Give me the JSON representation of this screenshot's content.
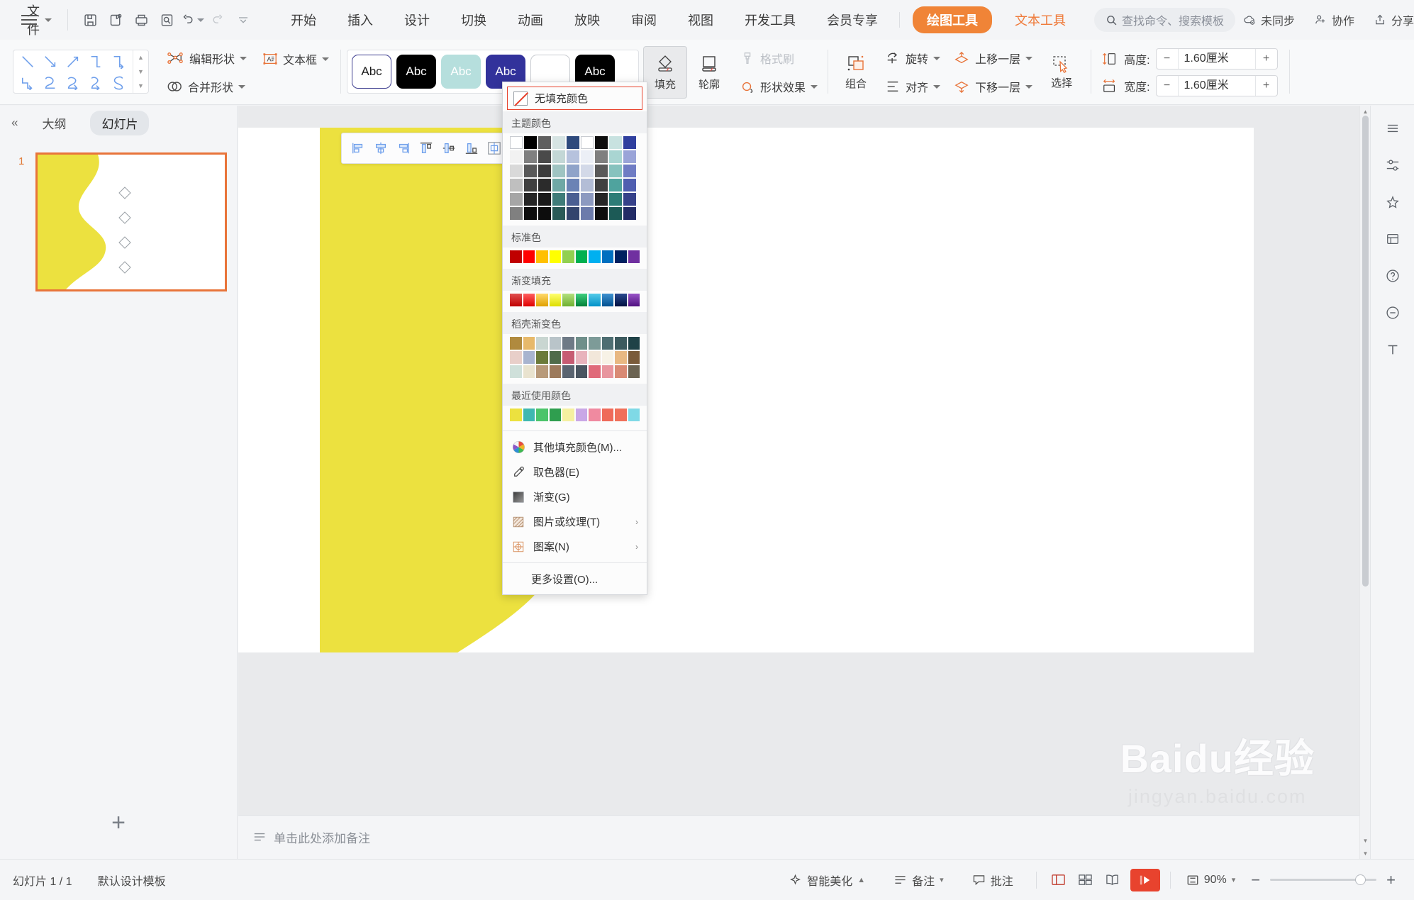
{
  "app": {
    "file_menu": "文件",
    "quick_access": [
      {
        "name": "save-icon",
        "title": "保存"
      },
      {
        "name": "save-as-icon",
        "title": "另存为"
      },
      {
        "name": "print-icon",
        "title": "打印"
      },
      {
        "name": "print-preview-icon",
        "title": "打印预览"
      },
      {
        "name": "undo-icon",
        "title": "撤销"
      },
      {
        "name": "redo-icon",
        "title": "恢复"
      },
      {
        "name": "customize-qat-icon",
        "title": "自定义快速访问工具栏"
      }
    ],
    "tabs": [
      {
        "label": "开始",
        "style": "normal"
      },
      {
        "label": "插入",
        "style": "normal"
      },
      {
        "label": "设计",
        "style": "normal"
      },
      {
        "label": "切换",
        "style": "normal"
      },
      {
        "label": "动画",
        "style": "normal"
      },
      {
        "label": "放映",
        "style": "normal"
      },
      {
        "label": "审阅",
        "style": "normal"
      },
      {
        "label": "视图",
        "style": "normal"
      },
      {
        "label": "开发工具",
        "style": "normal"
      },
      {
        "label": "会员专享",
        "style": "normal"
      },
      {
        "label": "绘图工具",
        "style": "pill"
      },
      {
        "label": "文本工具",
        "style": "accent"
      }
    ],
    "search_placeholder": "查找命令、搜索模板",
    "right_buttons": [
      {
        "label": "未同步",
        "icon": "cloud-off-icon"
      },
      {
        "label": "协作",
        "icon": "collaborate-icon"
      },
      {
        "label": "分享",
        "icon": "share-icon"
      }
    ],
    "more_icon": "more-vertical-icon",
    "collapse_ribbon_icon": "chevron-up-icon",
    "accent_color": "#f08437",
    "accent_text_color": "#ef7a3a"
  },
  "ribbon": {
    "shape_gallery": {
      "name": "line-shapes-gallery",
      "rows": [
        [
          "line-diagonal",
          "line-arrow-diagonal",
          "line-arrow-up",
          "elbow-connector",
          "elbow-arrow-connector"
        ],
        [
          "elbow-arrow-2",
          "curve-connector",
          "curve-arrow-connector",
          "curve-arrow-2",
          "s-curve"
        ]
      ]
    },
    "edit_shape": "编辑形状",
    "merge_shape": "合并形状",
    "text_box": "文本框",
    "style_swatches": [
      {
        "name": "style-white",
        "bg": "#ffffff",
        "text": "Abc",
        "fg": "#1a1a1a",
        "border": "#3d3d8f"
      },
      {
        "name": "style-black",
        "bg": "#000000",
        "text": "Abc",
        "fg": "#ffffff",
        "border": "#000000"
      },
      {
        "name": "style-lightteal",
        "bg": "#b6dfdd",
        "text": "Abc",
        "fg": "#ffffff",
        "border": "#b6dfdd"
      },
      {
        "name": "style-indigo",
        "bg": "#32329b",
        "text": "Abc",
        "fg": "#ffffff",
        "border": "#32329b"
      },
      {
        "name": "style-plain-white",
        "bg": "#ffffff",
        "text": "",
        "fg": "#1a1a1a",
        "border": "#c9ccd1"
      },
      {
        "name": "style-black-2",
        "bg": "#000000",
        "text": "Abc",
        "fg": "#ffffff",
        "border": "#000000"
      }
    ],
    "fill_label": "填充",
    "outline_label": "轮廓",
    "format_painter": "格式刷",
    "shape_effect": "形状效果",
    "group": "组合",
    "rotate": "旋转",
    "bring_forward": "上移一层",
    "align": "对齐",
    "send_backward": "下移一层",
    "select": "选择",
    "height_label": "高度:",
    "height_value": "1.60厘米",
    "width_label": "宽度:",
    "width_value": "1.60厘米",
    "minus": "−",
    "plus": "+"
  },
  "left_panel": {
    "collapse": "«",
    "tabs": [
      {
        "label": "大纲",
        "selected": false
      },
      {
        "label": "幻灯片",
        "selected": true
      }
    ],
    "slide_number": "1",
    "add_slide": "+"
  },
  "canvas": {
    "align_toolbar": [
      "align-left-icon",
      "align-center-h-icon",
      "align-right-icon",
      "align-top-icon",
      "align-middle-icon",
      "align-bottom-icon",
      "distribute-h-icon",
      "distribute-v-icon"
    ],
    "notes_placeholder": "单击此处添加备注",
    "slide_shape_color": "#ece13f"
  },
  "fill_menu": {
    "no_fill": "无填充颜色",
    "sections": [
      {
        "title": "主题颜色",
        "name": "theme-colors"
      },
      {
        "title": "标准色",
        "name": "standard-colors"
      },
      {
        "title": "渐变填充",
        "name": "gradient-fill"
      },
      {
        "title": "稻壳渐变色",
        "name": "docer-gradient-colors"
      },
      {
        "title": "最近使用颜色",
        "name": "recent-colors"
      }
    ],
    "theme_row1": [
      "#ffffff",
      "#000000",
      "#5f5f5f",
      "#d6e4e3",
      "#2e4a7d",
      "#ffffff",
      "#0d0d0d",
      "#c8e2e0",
      "#2f3f9e"
    ],
    "theme_grid": [
      [
        "#f2f2f2",
        "#808080",
        "#4a4a4a",
        "#c3d7d6",
        "#b6c2dd",
        "#eceff6",
        "#7f7f7f",
        "#a9d5d2",
        "#9aa4d8"
      ],
      [
        "#d9d9d9",
        "#595959",
        "#3c3c3c",
        "#9fc4c2",
        "#8fa3c9",
        "#d3d9e8",
        "#595959",
        "#86c2be",
        "#6f7cc4"
      ],
      [
        "#bfbfbf",
        "#404040",
        "#2b2b2b",
        "#6fa8a5",
        "#6b83b5",
        "#b3bdd6",
        "#404040",
        "#4fa39e",
        "#4f5eb0"
      ],
      [
        "#a6a6a6",
        "#262626",
        "#1a1a1a",
        "#3f7c79",
        "#4a5f92",
        "#8d9ac0",
        "#262626",
        "#2d7c77",
        "#36418a"
      ],
      [
        "#808080",
        "#0d0d0d",
        "#0d0d0d",
        "#2a5insufficient",
        "#33456d",
        "#6c7bab",
        "#0d0d0d",
        "#1c5a56",
        "#232c66"
      ]
    ],
    "standard_colors": [
      "#c00000",
      "#ff0000",
      "#ffc000",
      "#ffff00",
      "#92d050",
      "#00b050",
      "#00b0f0",
      "#0070c0",
      "#002060",
      "#7030a0"
    ],
    "gradient_colors": [
      "#c00000",
      "#ff0000",
      "#ffc000",
      "#ffff00",
      "#92d050",
      "#00b050",
      "#00b0f0",
      "#0070c0",
      "#002060",
      "#7030a0"
    ],
    "docer_rows": [
      [
        "#b08a3e",
        "#e7b96a",
        "#c9d6d1",
        "#b9c4c9",
        "#6e7a86",
        "#6f8f8a",
        "#7d9b98",
        "#4e6e72",
        "#3c5a5e",
        "#1f4247"
      ],
      [
        "#e8cfc9",
        "#a8b4cf",
        "#6b7a3a",
        "#4f6b4a",
        "#c75b72",
        "#e8b3bc",
        "#f2e7da",
        "#f7f2e6",
        "#e8b882",
        "#7a5b3a"
      ],
      [
        "#cfe0da",
        "#e9e3cf",
        "#b89a7a",
        "#9c7a5c",
        "#5a6470",
        "#4a5560",
        "#e06a7a",
        "#e8959e",
        "#d98a74",
        "#6b6352"
      ]
    ],
    "recent_colors": [
      "#ece13f",
      "#3fb8b0",
      "#4cc46a",
      "#2f9e4f",
      "#f5f0a0",
      "#c9a7e6",
      "#f08aa0",
      "#ef6a5a",
      "#f0705a",
      "#7fd9e6"
    ],
    "items": [
      {
        "label": "其他填充颜色(M)...",
        "icon": "color-wheel-icon",
        "arrow": false
      },
      {
        "label": "取色器(E)",
        "icon": "eyedropper-icon",
        "arrow": false
      },
      {
        "label": "渐变(G)",
        "icon": "gradient-icon",
        "arrow": false
      },
      {
        "label": "图片或纹理(T)",
        "icon": "picture-texture-icon",
        "arrow": true
      },
      {
        "label": "图案(N)",
        "icon": "pattern-icon",
        "arrow": true
      }
    ],
    "more_settings": "更多设置(O)...",
    "highlight_color": "#e8432e"
  },
  "right_rail": [
    {
      "name": "panel-handle-icon",
      "glyph": "≡"
    },
    {
      "name": "properties-icon",
      "glyph": "⚙"
    },
    {
      "name": "star-icon",
      "glyph": "✦"
    },
    {
      "name": "layers-icon",
      "glyph": "▤"
    },
    {
      "name": "help-icon",
      "glyph": "?"
    },
    {
      "name": "minus-circle-icon",
      "glyph": "⊖"
    },
    {
      "name": "text-tool-icon",
      "glyph": "T"
    }
  ],
  "status_bar": {
    "slide_count": "幻灯片 1 / 1",
    "template": "默认设计模板",
    "beautify": "智能美化",
    "notes": "备注",
    "comments": "批注",
    "views": [
      "normal-view-icon",
      "slide-sorter-icon",
      "reading-view-icon"
    ],
    "play": "play-icon",
    "zoom_label": "90%",
    "zoom_out": "−",
    "zoom_in": "+"
  },
  "watermark": {
    "big": "Baidu经验",
    "small": "jingyan.baidu.com"
  }
}
